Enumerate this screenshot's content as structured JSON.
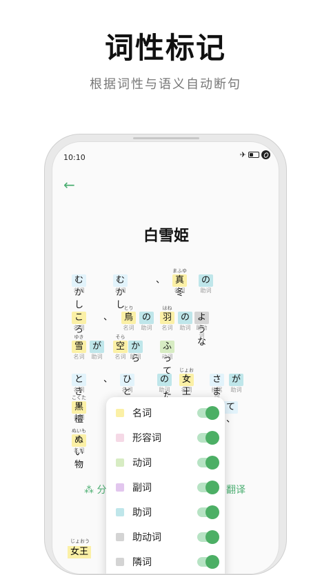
{
  "hero": {
    "title": "词性标记",
    "subtitle": "根据词性与语义自动断句"
  },
  "status": {
    "time": "10:10"
  },
  "story": {
    "title": "白雪姫"
  },
  "tokens": [
    {
      "ruby": "",
      "word": "むかし",
      "pos": "名词",
      "color": "blue"
    },
    {
      "ruby": "",
      "word": "むかし",
      "pos": "名词",
      "color": "blue"
    },
    {
      "ruby": "",
      "word": "、",
      "pos": "",
      "color": "none"
    },
    {
      "ruby": "まふゆ",
      "word": "真冬",
      "pos": "名词",
      "color": "yel"
    },
    {
      "ruby": "",
      "word": "の",
      "pos": "助词",
      "color": "teal"
    },
    {
      "ruby": "",
      "word": "ころ",
      "pos": "名词",
      "color": "yel"
    },
    {
      "ruby": "",
      "word": "、",
      "pos": "",
      "color": "none"
    },
    {
      "ruby": "とり",
      "word": "鳥",
      "pos": "名词",
      "color": "yel"
    },
    {
      "ruby": "",
      "word": "の",
      "pos": "助词",
      "color": "teal"
    },
    {
      "ruby": "はね",
      "word": "羽",
      "pos": "名词",
      "color": "yel"
    },
    {
      "ruby": "",
      "word": "の",
      "pos": "助词",
      "color": "teal"
    },
    {
      "ruby": "",
      "word": "ような",
      "pos": "助动词",
      "color": "gray"
    },
    {
      "ruby": "ゆき",
      "word": "雪",
      "pos": "名词",
      "color": "yel"
    },
    {
      "ruby": "",
      "word": "が",
      "pos": "助词",
      "color": "teal"
    },
    {
      "ruby": "そら",
      "word": "空",
      "pos": "名词",
      "color": "yel"
    },
    {
      "ruby": "",
      "word": "から",
      "pos": "助词",
      "color": "teal"
    },
    {
      "ruby": "",
      "word": "ふっていた",
      "pos": "动词",
      "color": "grn"
    },
    {
      "ruby": "",
      "word": "とき",
      "pos": "名词",
      "color": "blue"
    },
    {
      "ruby": "",
      "word": "、",
      "pos": "",
      "color": "none"
    },
    {
      "ruby": "",
      "word": "ひとり",
      "pos": "名词",
      "color": "blue"
    },
    {
      "ruby": "",
      "word": "の",
      "pos": "助词",
      "color": "teal"
    },
    {
      "ruby": "じょおう",
      "word": "女王",
      "pos": "名词",
      "color": "yel"
    },
    {
      "ruby": "",
      "word": "さま",
      "pos": "接尾词",
      "color": "blue"
    },
    {
      "ruby": "",
      "word": "が",
      "pos": "助词",
      "color": "teal"
    },
    {
      "ruby": "こくたん",
      "word": "黒檀",
      "pos": "名词",
      "color": "yel"
    },
    {
      "ruby": "",
      "word": "て 、",
      "pos": "",
      "color": "blue"
    },
    {
      "ruby": "ぬいもの",
      "word": "ぬい物",
      "pos": "名词",
      "color": "yel"
    }
  ],
  "actions": {
    "share": "分",
    "translate": "翻译"
  },
  "pos_filters": [
    {
      "label": "名词",
      "color": "#fbf0a6"
    },
    {
      "label": "形容词",
      "color": "#f5d9e6"
    },
    {
      "label": "动词",
      "color": "#d7ecc3"
    },
    {
      "label": "副词",
      "color": "#e2c6ee"
    },
    {
      "label": "助词",
      "color": "#bfe6ea"
    },
    {
      "label": "助动词",
      "color": "#d4d4d4"
    },
    {
      "label": "隣词",
      "color": "#d4d4d4"
    }
  ],
  "bottom": {
    "ruby": "じょおう",
    "word": "女王"
  }
}
